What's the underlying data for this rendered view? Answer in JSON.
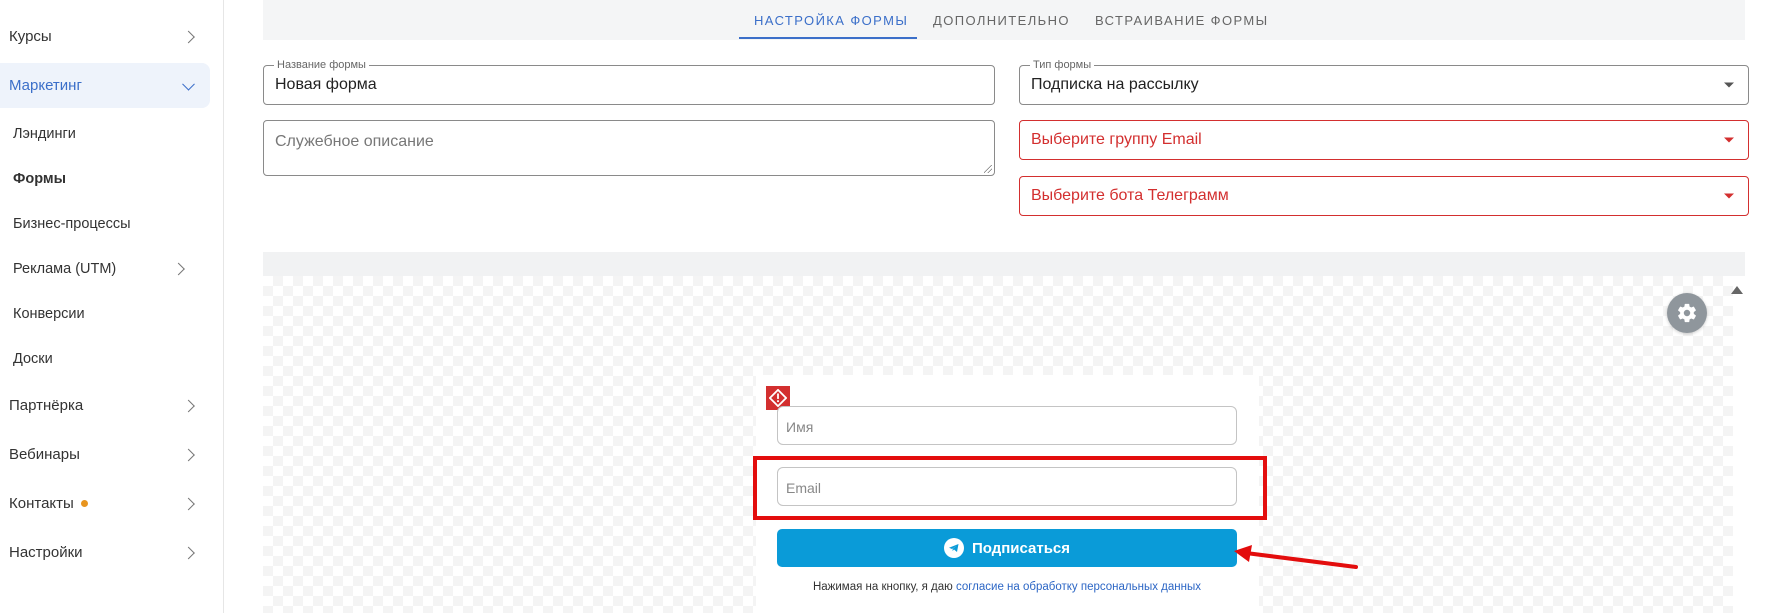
{
  "sidebar": {
    "items": [
      {
        "label": "Курсы"
      },
      {
        "label": "Маркетинг"
      },
      {
        "label": "Лэндинги"
      },
      {
        "label": "Формы"
      },
      {
        "label": "Бизнес-процессы"
      },
      {
        "label": "Реклама (UTM)"
      },
      {
        "label": "Конверсии"
      },
      {
        "label": "Доски"
      },
      {
        "label": "Партнёрка"
      },
      {
        "label": "Вебинары"
      },
      {
        "label": "Контакты"
      },
      {
        "label": "Настройки"
      }
    ]
  },
  "tabs": [
    {
      "label": "НАСТРОЙКА ФОРМЫ"
    },
    {
      "label": "ДОПОЛНИТЕЛЬНО"
    },
    {
      "label": "ВСТРАИВАНИЕ ФОРМЫ"
    }
  ],
  "form": {
    "name_label": "Название формы",
    "name_value": "Новая форма",
    "description_placeholder": "Служебное описание",
    "type_label": "Тип формы",
    "type_value": "Подписка на рассылку",
    "email_group_placeholder": "Выберите группу Email",
    "telegram_bot_placeholder": "Выберите бота Телеграмм"
  },
  "preview": {
    "name_placeholder": "Имя",
    "email_placeholder": "Email",
    "subscribe_label": "Подписаться",
    "consent_text": "Нажимая на кнопку, я даю",
    "consent_link": "согласие на обработку персональных данных"
  },
  "colors": {
    "accent": "#3b6fc9",
    "error": "#d32f2f",
    "button": "#0a9bd8",
    "highlight": "#e30d0d"
  }
}
